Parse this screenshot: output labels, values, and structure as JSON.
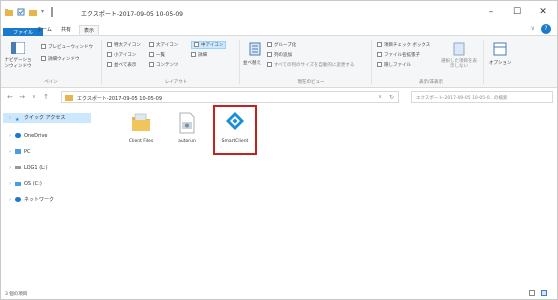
{
  "titlebar": {
    "title": "エクスポート-2017-09-05 10-05-09",
    "minimize": "–",
    "maximize": "☐",
    "close": "✕"
  },
  "tabs": [
    {
      "label": "ファイル"
    },
    {
      "label": "ホーム"
    },
    {
      "label": "共有"
    },
    {
      "label": "表示"
    }
  ],
  "ribbon": {
    "pane_group": {
      "nav_pane": "ナビゲーションウィンドウ",
      "preview_pane": "プレビューウィンドウ",
      "details_pane": "詳細ウィンドウ",
      "label": "ペイン"
    },
    "layout_group": {
      "items": [
        "特大アイコン",
        "大アイコン",
        "中アイコン",
        "小アイコン",
        "一覧",
        "詳細",
        "並べて表示",
        "コンテンツ"
      ],
      "label": "レイアウト"
    },
    "view_group": {
      "sort": "並べ替え",
      "group_by": "グループ化",
      "add_column": "列の追加",
      "fit_columns": "すべての列のサイズを自動的に変更する",
      "label": "現在のビュー"
    },
    "show_group": {
      "item_checkbox": "項目チェック ボックス",
      "extensions": "ファイル名拡張子",
      "hidden_items": "隠しファイル",
      "hide_selected": "選択した項目を表示しない",
      "label": "表示/非表示"
    },
    "options": "オプション"
  },
  "address": {
    "path": "エクスポート-2017-09-05 10-05-09",
    "search_placeholder": "エクスポート-2017-09-05 10-05-0.. の検索"
  },
  "nav": [
    {
      "label": "クイック アクセス",
      "icon": "star-icon",
      "selected": true
    },
    {
      "label": "OneDrive",
      "icon": "cloud-icon"
    },
    {
      "label": "PC",
      "icon": "pc-icon"
    },
    {
      "label": "LOG1 (L:)",
      "icon": "drive-icon"
    },
    {
      "label": "OS (C:)",
      "icon": "drive-icon"
    },
    {
      "label": "ネットワーク",
      "icon": "network-icon"
    }
  ],
  "files": [
    {
      "label": "Client Files",
      "icon": "folder-icon"
    },
    {
      "label": "autorun",
      "icon": "autorun-file-icon"
    },
    {
      "label": "SmartClient",
      "icon": "smartclient-icon"
    }
  ],
  "status": {
    "count": "3 個の項目"
  },
  "colors": {
    "accent": "#1979ca",
    "highlight": "#c8201c",
    "folder": "#e8b54a",
    "smartclient": "#1a8fd8"
  }
}
